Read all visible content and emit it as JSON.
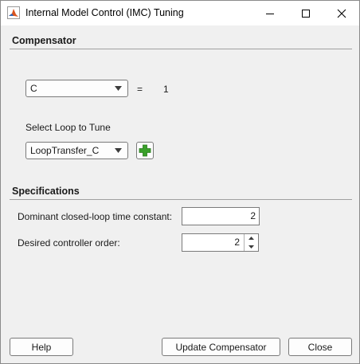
{
  "window": {
    "title": "Internal Model Control (IMC) Tuning",
    "icon": "matlab-icon",
    "controls": [
      "minimize-icon",
      "maximize-icon",
      "close-icon"
    ]
  },
  "compensator_section": {
    "header": "Compensator",
    "selected_compensator": "C",
    "equals_sign": "=",
    "compensator_value": "1",
    "loop_label": "Select Loop to Tune",
    "selected_loop": "LoopTransfer_C",
    "add_loop_icon": "plus-icon"
  },
  "specifications_section": {
    "header": "Specifications",
    "time_constant_label": "Dominant closed-loop time constant:",
    "time_constant_value": "2",
    "order_label": "Desired controller order:",
    "order_value": "2"
  },
  "buttons": {
    "help": "Help",
    "update": "Update Compensator",
    "close": "Close"
  },
  "colors": {
    "window_bg": "#f0f0f0",
    "titlebar_bg": "#ffffff",
    "plus_icon_green": "#3aa02a"
  }
}
